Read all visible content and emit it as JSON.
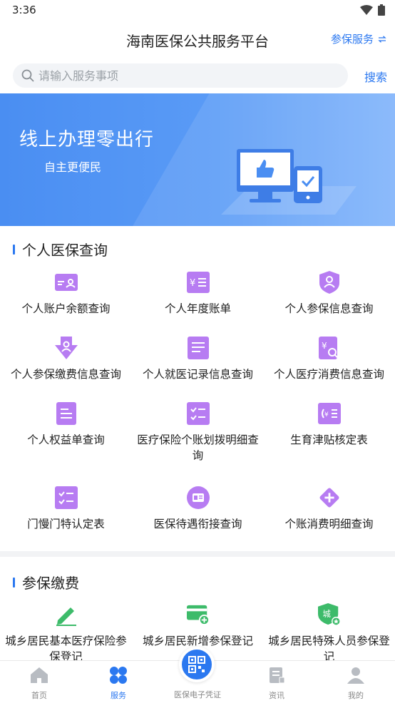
{
  "status_bar": {
    "time": "3:36"
  },
  "header": {
    "title": "海南医保公共服务平台",
    "switch_label": "参保服务"
  },
  "search": {
    "placeholder": "请输入服务事项",
    "button_label": "搜索"
  },
  "banner": {
    "title": "线上办理零出行",
    "subtitle": "自主更便民"
  },
  "personal": {
    "title": "个人医保查询",
    "items": [
      {
        "label": "个人账户余额查询",
        "icon": "card-user-icon"
      },
      {
        "label": "个人年度账单",
        "icon": "yen-bill-icon"
      },
      {
        "label": "个人参保信息查询",
        "icon": "shield-user-icon"
      },
      {
        "label": "个人参保缴费信息查询",
        "icon": "download-user-icon"
      },
      {
        "label": "个人就医记录信息查询",
        "icon": "medical-record-icon"
      },
      {
        "label": "个人医疗消费信息查询",
        "icon": "yen-search-icon"
      },
      {
        "label": "个人权益单查询",
        "icon": "document-icon"
      },
      {
        "label": "医疗保险个账划拨明细查询",
        "icon": "checklist-icon"
      },
      {
        "label": "生育津贴核定表",
        "icon": "allowance-icon"
      },
      {
        "label": "门慢门特认定表",
        "icon": "checklist-icon"
      },
      {
        "label": "医保待遇衔接查询",
        "icon": "id-card-icon"
      },
      {
        "label": "个账消费明细查询",
        "icon": "plus-diamond-icon"
      }
    ]
  },
  "insurance": {
    "title": "参保缴费",
    "items": [
      {
        "label": "城乡居民基本医疗保险参保登记",
        "icon": "pencil-icon"
      },
      {
        "label": "城乡居民新增参保登记",
        "icon": "card-add-icon"
      },
      {
        "label": "城乡居民特殊人员参保登记",
        "icon": "city-badge-icon",
        "badge": "城"
      }
    ]
  },
  "tabbar": {
    "items": [
      {
        "label": "首页",
        "icon": "home-icon"
      },
      {
        "label": "服务",
        "icon": "services-icon"
      },
      {
        "label": "医保电子凭证",
        "icon": "qr-code-icon"
      },
      {
        "label": "资讯",
        "icon": "news-icon"
      },
      {
        "label": "我的",
        "icon": "profile-icon"
      }
    ],
    "active": "服务"
  },
  "colors": {
    "accent": "#2b78f0",
    "icon_purple": "#b77cf2",
    "icon_green": "#3dbb6a",
    "banner": "#4a8ef2"
  }
}
